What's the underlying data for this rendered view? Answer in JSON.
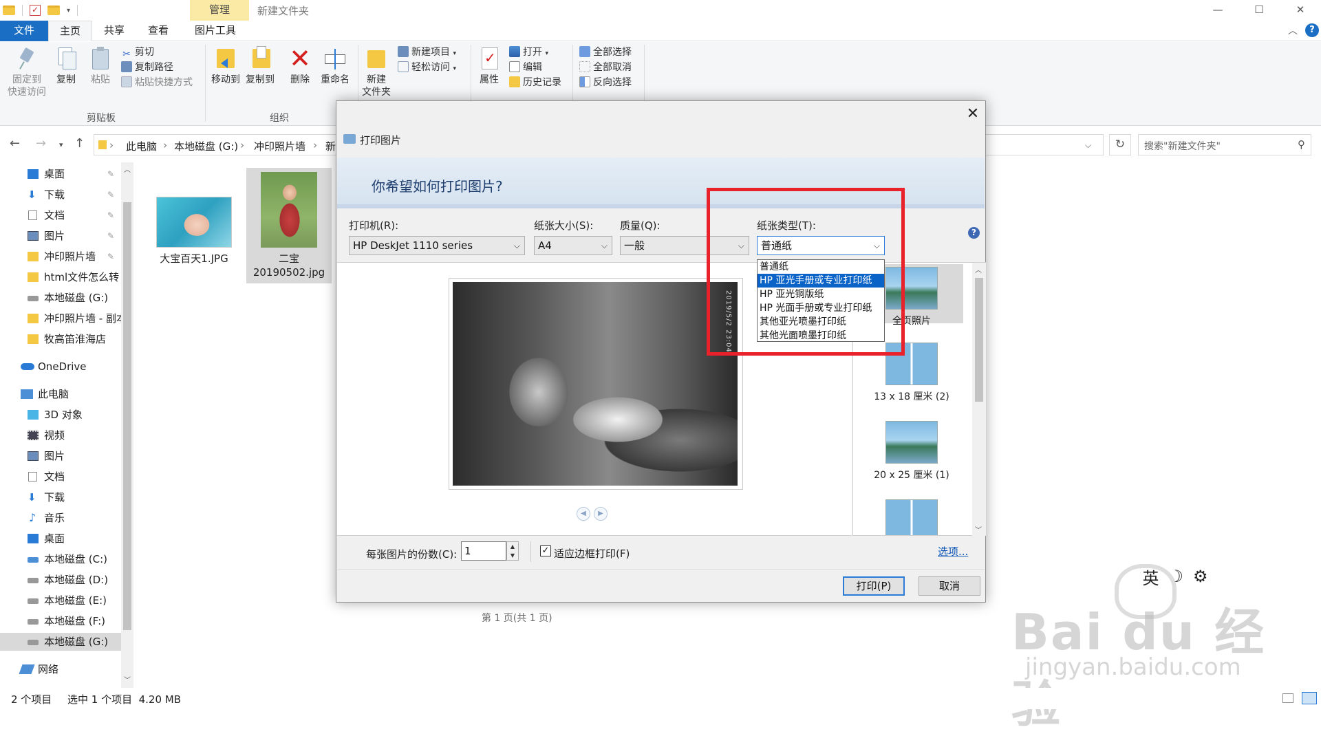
{
  "titlebar": {
    "manage_tab": "管理",
    "window_title": "新建文件夹",
    "minimize": "—",
    "maximize": "☐",
    "close": "✕"
  },
  "tabs": {
    "file": "文件",
    "home": "主页",
    "share": "共享",
    "view": "查看",
    "picture_tools": "图片工具"
  },
  "ribbon": {
    "pin_quick_access": [
      "固定到",
      "快速访问"
    ],
    "copy": "复制",
    "paste": "粘贴",
    "cut": "剪切",
    "copy_path": "复制路径",
    "paste_shortcut": "粘贴快捷方式",
    "clipboard_label": "剪贴板",
    "move_to": "移动到",
    "copy_to": "复制到",
    "delete": "删除",
    "rename": "重命名",
    "organize_label": "组织",
    "new_folder": [
      "新建",
      "文件夹"
    ],
    "new_item": "新建项目",
    "easy_access": "轻松访问",
    "properties": "属性",
    "open": "打开",
    "edit": "编辑",
    "history": "历史记录",
    "select_all": "全部选择",
    "select_none": "全部取消",
    "invert_selection": "反向选择"
  },
  "address": {
    "crumbs": [
      "此电脑",
      "本地磁盘 (G:)",
      "冲印照片墙",
      "新"
    ],
    "search_placeholder": "搜索\"新建文件夹\""
  },
  "nav": {
    "items": [
      "桌面",
      "下载",
      "文档",
      "图片",
      "冲印照片墙",
      "html文件怎么转",
      "本地磁盘 (G:)",
      "冲印照片墙 - 副本",
      "牧高笛淮海店",
      "OneDrive",
      "此电脑",
      "3D 对象",
      "视频",
      "图片",
      "文档",
      "下载",
      "音乐",
      "桌面",
      "本地磁盘 (C:)",
      "本地磁盘 (D:)",
      "本地磁盘 (E:)",
      "本地磁盘 (F:)",
      "本地磁盘 (G:)",
      "网络"
    ]
  },
  "files": [
    {
      "name": "大宝百天1.JPG"
    },
    {
      "name": "二宝",
      "name2": "20190502.jpg"
    }
  ],
  "dialog": {
    "title": "打印图片",
    "question": "你希望如何打印图片?",
    "printer_label": "打印机(R):",
    "printer_value": "HP DeskJet 1110 series",
    "paper_size_label": "纸张大小(S):",
    "paper_size_value": "A4",
    "quality_label": "质量(Q):",
    "quality_value": "一般",
    "paper_type_label": "纸张类型(T):",
    "paper_type_value": "普通纸",
    "paper_type_options": [
      "普通纸",
      "HP 亚光手册或专业打印纸",
      "HP 亚光铜版纸",
      "HP 光面手册或专业打印纸",
      "其他亚光喷墨打印纸",
      "其他光面喷墨打印纸"
    ],
    "photo_watermark": "2019/5/2 23:04",
    "page_label": "第 1 页(共 1 页)",
    "layouts": [
      "全页照片",
      "13 x 18 厘米 (2)",
      "20 x 25 厘米 (1)"
    ],
    "copies_label": "每张图片的份数(C):",
    "copies_value": "1",
    "fit_label": "适应边框打印(F)",
    "options_link": "选项...",
    "print_button": "打印(P)",
    "cancel_button": "取消"
  },
  "status": {
    "count": "2 个项目",
    "selection": "选中 1 个项目  4.20 MB"
  },
  "ime": {
    "lang": "英",
    "moon": "☽",
    "gear": "⚙"
  },
  "watermark": {
    "brand": "Bai du 经验",
    "url": "jingyan.baidu.com"
  }
}
